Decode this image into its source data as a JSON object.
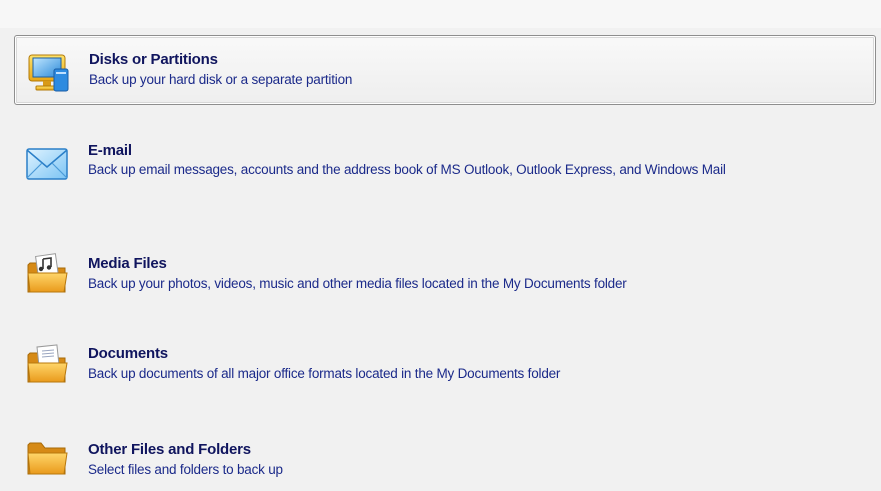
{
  "options": [
    {
      "icon": "computer-monitor-icon",
      "title": "Disks or Partitions",
      "description": "Back up your hard disk or a separate partition"
    },
    {
      "icon": "envelope-icon",
      "title": "E-mail",
      "description": "Back up email messages, accounts and the address book of MS Outlook, Outlook Express, and Windows Mail"
    },
    {
      "icon": "media-folder-icon",
      "title": "Media Files",
      "description": "Back up your photos, videos, music and other media files located in the My Documents folder"
    },
    {
      "icon": "documents-folder-icon",
      "title": "Documents",
      "description": "Back up documents of all major office formats located in the My Documents folder"
    },
    {
      "icon": "folder-icon",
      "title": "Other Files and Folders",
      "description": "Select files and folders to back up"
    }
  ],
  "colors": {
    "title": "#10155e",
    "description": "#1b2a8a",
    "background": "#f1f1f1",
    "selected_border": "#8e8e8e"
  }
}
